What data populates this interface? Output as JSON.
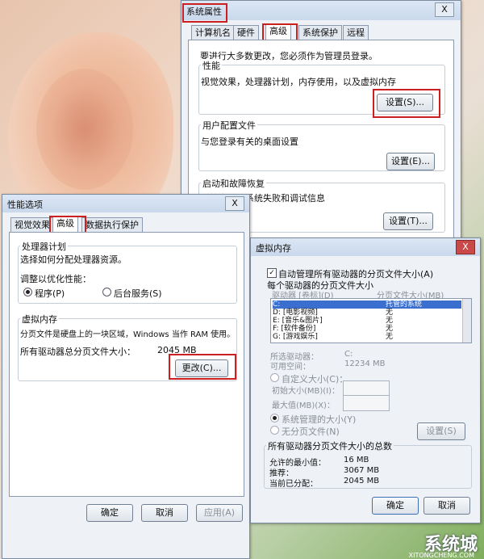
{
  "sys_props": {
    "title": "系统属性",
    "close": "X",
    "tabs": [
      "计算机名",
      "硬件",
      "高级",
      "系统保护",
      "远程"
    ],
    "admin_note": "要进行大多数更改，您必须作为管理员登录。",
    "perf_title": "性能",
    "perf_desc": "视觉效果，处理器计划，内存使用，以及虚拟内存",
    "perf_btn": "设置(S)...",
    "profile_title": "用户配置文件",
    "profile_desc": "与您登录有关的桌面设置",
    "profile_btn": "设置(E)...",
    "startup_title": "启动和故障恢复",
    "startup_desc": "系统启动、系统失败和调试信息",
    "startup_btn": "设置(T)..."
  },
  "perf_opts": {
    "title": "性能选项",
    "close": "X",
    "tabs": [
      "视觉效果",
      "高级",
      "数据执行保护"
    ],
    "cpu_title": "处理器计划",
    "cpu_desc": "选择如何分配处理器资源。",
    "adjust_label": "调整以优化性能：",
    "radio_programs": "程序(P)",
    "radio_services": "后台服务(S)",
    "vm_title": "虚拟内存",
    "vm_desc": "分页文件是硬盘上的一块区域，Windows 当作 RAM 使用。",
    "vm_total_label": "所有驱动器总分页文件大小：",
    "vm_total_value": "2045 MB",
    "change_btn": "更改(C)...",
    "ok": "确定",
    "cancel": "取消",
    "apply": "应用(A)"
  },
  "vmem": {
    "title": "虚拟内存",
    "close": "X",
    "auto_label": "自动管理所有驱动器的分页文件大小(A)",
    "per_drive_label": "每个驱动器的分页文件大小",
    "col_drive": "驱动器 [卷标](D)",
    "col_size": "分页文件大小(MB)",
    "rows": [
      {
        "drive": "C:",
        "size": "托管的系统"
      },
      {
        "drive": "D:   [电影视频]",
        "size": "无"
      },
      {
        "drive": "E:   [音乐&图片]",
        "size": "无"
      },
      {
        "drive": "F:   [软件备份]",
        "size": "无"
      },
      {
        "drive": "G:   [游戏娱乐]",
        "size": "无"
      }
    ],
    "selected_drive_label": "所选驱动器：",
    "selected_drive_value": "C:",
    "space_label": "可用空间：",
    "space_value": "12234 MB",
    "custom_label": "自定义大小(C)：",
    "initial_label": "初始大小(MB)(I)：",
    "max_label": "最大值(MB)(X)：",
    "system_managed_label": "系统管理的大小(Y)",
    "no_paging_label": "无分页文件(N)",
    "set_btn": "设置(S)",
    "totals_title": "所有驱动器分页文件大小的总数",
    "min_label": "允许的最小值：",
    "min_value": "16 MB",
    "rec_label": "推荐：",
    "rec_value": "3067 MB",
    "cur_label": "当前已分配：",
    "cur_value": "2045 MB",
    "ok": "确定",
    "cancel": "取消"
  },
  "watermark": {
    "brand": "系统城",
    "url": "XITONGCHENG.COM"
  }
}
